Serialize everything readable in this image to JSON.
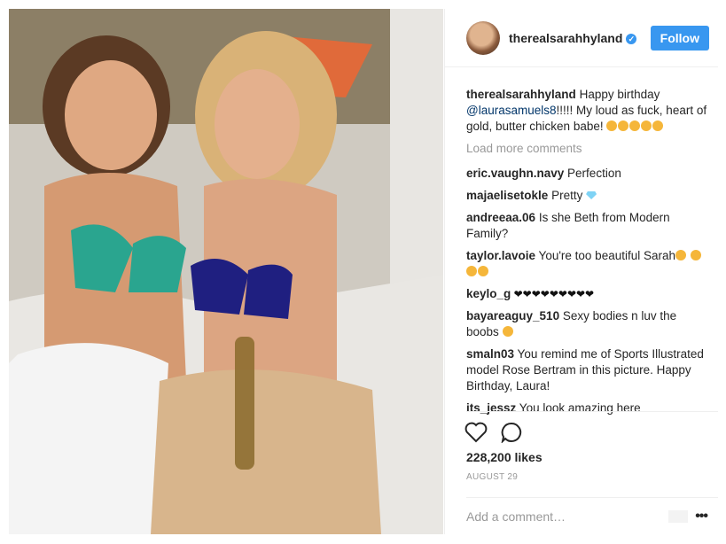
{
  "post": {
    "username": "therealsarahhyland",
    "follow_label": "Follow",
    "caption_user": "therealsarahhyland",
    "caption_text": " Happy birthday ",
    "caption_mention": "@laurasamuels8",
    "caption_rest": "!!!!! My loud as fuck, heart of gold, butter chicken babe! ",
    "load_more": "Load more comments",
    "comments": [
      {
        "user": "eric.vaughn.navy",
        "text": " Perfection"
      },
      {
        "user": "majaelisetokle",
        "text": " Pretty "
      },
      {
        "user": "andreeaa.06",
        "text": " Is she Beth from Modern Family?"
      },
      {
        "user": "taylor.lavoie",
        "text": " You're too beautiful Sarah"
      },
      {
        "user": "keylo_g",
        "text": " ❤❤❤❤❤❤❤❤❤"
      },
      {
        "user": "bayareaguy_510",
        "text": " Sexy bodies n luv the boobs "
      },
      {
        "user": "smaln03",
        "text": " You remind me of Sports Illustrated model Rose Bertram in this picture. Happy Birthday, Laura!"
      },
      {
        "user": "its_jessz",
        "text": " You look amazing here"
      }
    ],
    "likes": "228,200 likes",
    "date": "AUGUST 29",
    "add_comment_placeholder": "Add a comment…",
    "more_options": "•••"
  },
  "icons": [
    "heart-icon",
    "comment-icon",
    "verified-badge-icon",
    "more-options-icon"
  ],
  "colors": {
    "accent": "#3897f0",
    "mention": "#003569",
    "muted": "#999999"
  }
}
